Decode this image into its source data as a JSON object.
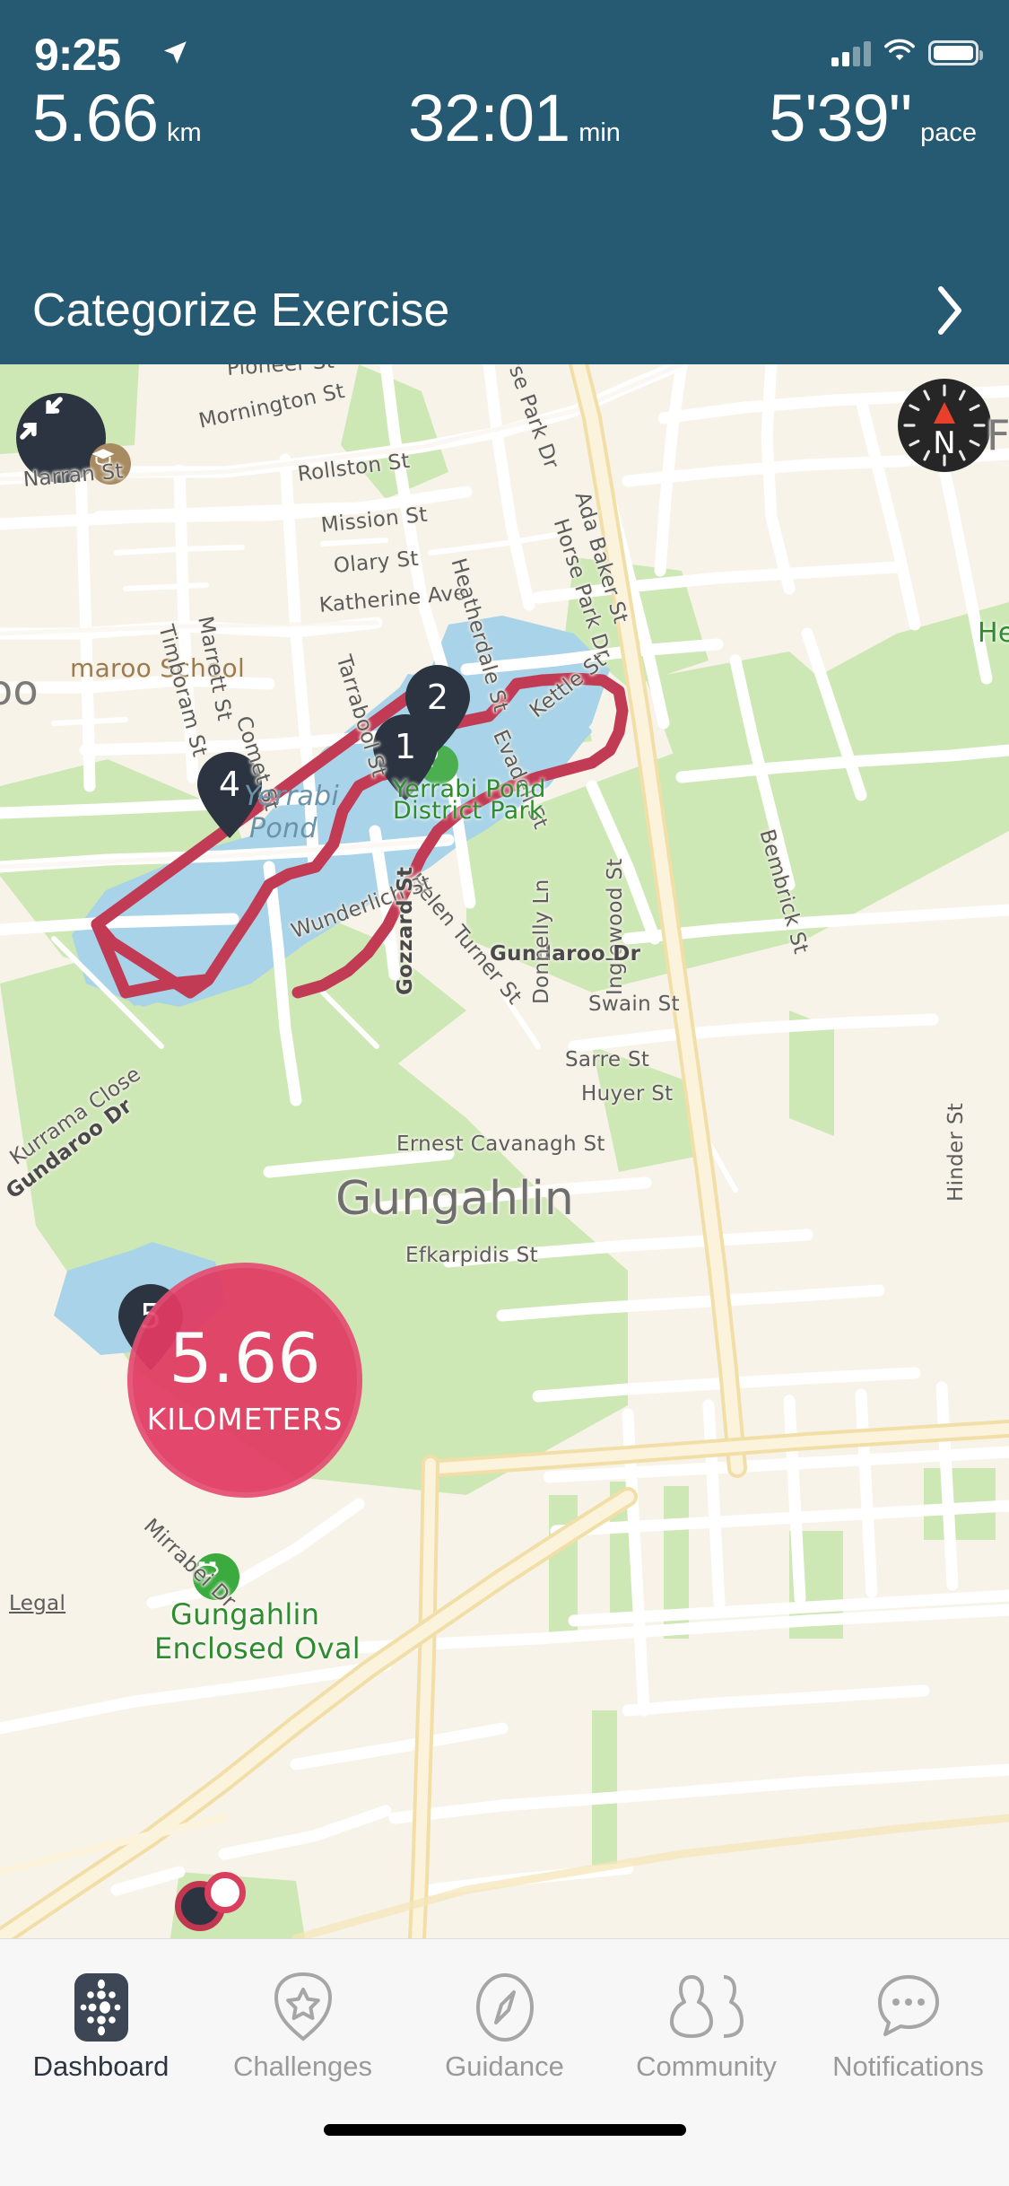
{
  "status_bar": {
    "time": "9:25",
    "location_icon": "location-arrow-icon",
    "cellular_icon": "cellular-signal-icon",
    "wifi_icon": "wifi-icon",
    "battery_icon": "battery-icon"
  },
  "metrics": [
    {
      "value": "5.66",
      "unit": "km",
      "name": "distance"
    },
    {
      "value": "32:01",
      "unit": "min",
      "name": "duration"
    },
    {
      "value": "5'39\"",
      "unit": "pace",
      "name": "pace"
    }
  ],
  "header": {
    "background_color": "#255A72",
    "categorize_label": "Categorize Exercise",
    "chevron_icon": "chevron-right-icon"
  },
  "map": {
    "collapse_icon": "collapse-fullscreen-icon",
    "compass": {
      "icon": "compass-icon",
      "north_label": "N",
      "needle_color": "#E8402A"
    },
    "route_color": "#C23B55",
    "distance_bubble": {
      "value": "5.66",
      "unit": "KILOMETERS",
      "color": "#E23A63"
    },
    "markers": [
      {
        "label": "1"
      },
      {
        "label": "2"
      },
      {
        "label": "4"
      },
      {
        "label": "5"
      }
    ],
    "pois": [
      {
        "name": "Amaroo School",
        "icon": "graduation-cap-icon",
        "color": "#A98B62"
      },
      {
        "name": "Yerrabi Pond District Park",
        "icon": "tree-icon",
        "color": "#4BAE4F"
      },
      {
        "name": "Gungahlin Enclosed Oval",
        "icon": "stadium-icon",
        "color": "#3CAB3F"
      }
    ],
    "labels": {
      "school": "maroo School",
      "water_line1": "Yerrabi",
      "water_line2": "Pond",
      "park_line1": "Yerrabi Pond",
      "park_line2": "District Park",
      "oval_line1": "Gungahlin",
      "oval_line2": "Enclosed Oval",
      "city": "Gungahlin",
      "left_edge": "oo",
      "right_edge": "F",
      "right_park_edge": "Her",
      "legal": "Legal"
    },
    "streets": [
      "Pioneer St",
      "Mornington St",
      "Rollston St",
      "Mission St",
      "Olary St",
      "Katherine Ave",
      "Narran St",
      "Timboram St",
      "Marrett St",
      "Comet St",
      "Tarrabool St",
      "Heatherdale St",
      "Horse Park Dr",
      "Ada Baker St",
      "Kettle St",
      "Evadell St",
      "Bembrick St",
      "Inglewood St",
      "Helen Turner St",
      "Wunderlich St",
      "Gundaroo Dr",
      "Gozzard St",
      "Donnelly Ln",
      "Swain St",
      "Sarre St",
      "Huyer St",
      "Ernest Cavanagh St",
      "Kurrama Close",
      "Mirrabei Dr",
      "Hinder St",
      "Efkarpidis St"
    ]
  },
  "tabbar": {
    "items": [
      {
        "label": "Dashboard",
        "icon": "dashboard-dots-icon",
        "active": true
      },
      {
        "label": "Challenges",
        "icon": "star-shield-icon",
        "active": false
      },
      {
        "label": "Guidance",
        "icon": "compass-needle-icon",
        "active": false
      },
      {
        "label": "Community",
        "icon": "people-icon",
        "active": false
      },
      {
        "label": "Notifications",
        "icon": "chat-bubble-icon",
        "active": false
      }
    ]
  }
}
